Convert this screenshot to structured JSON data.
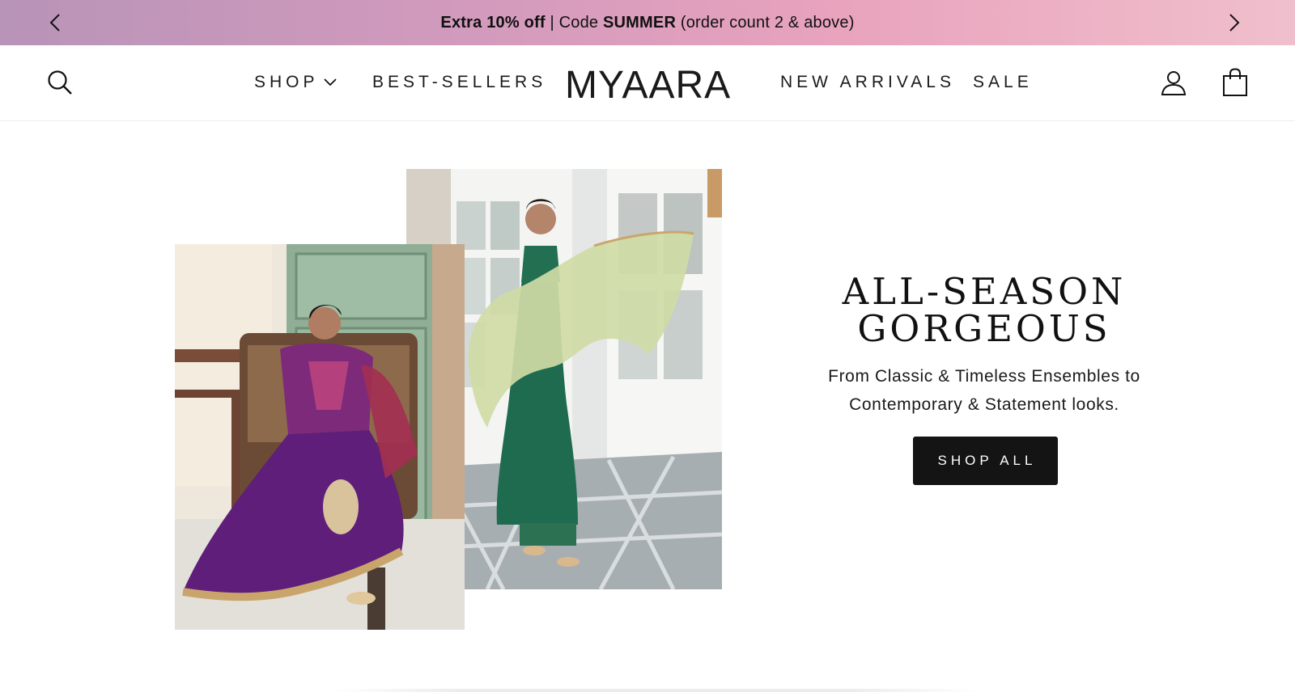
{
  "announcement": {
    "bold_1": "Extra 10% off",
    "text_1": " | Code ",
    "bold_2": "SUMMER",
    "text_2": " (order count 2 & above)",
    "gradient_colors": [
      "#b894b8",
      "#e9a3bd",
      "#f0bfcc"
    ]
  },
  "header": {
    "logo": "MYAARA",
    "nav": {
      "shop": "SHOP",
      "best_sellers": "BEST-SELLERS",
      "new_arrivals": "NEW ARRIVALS",
      "sale": "SALE"
    },
    "icons": [
      "search-icon",
      "chevron-down-icon",
      "account-icon",
      "shopping-bag-icon"
    ]
  },
  "hero": {
    "title_line_1": "ALL-SEASON",
    "title_line_2": "GORGEOUS",
    "subtitle_line_1": "From Classic & Timeless Ensembles to",
    "subtitle_line_2": "Contemporary & Statement looks.",
    "button": "SHOP ALL",
    "button_color": "#141414"
  }
}
